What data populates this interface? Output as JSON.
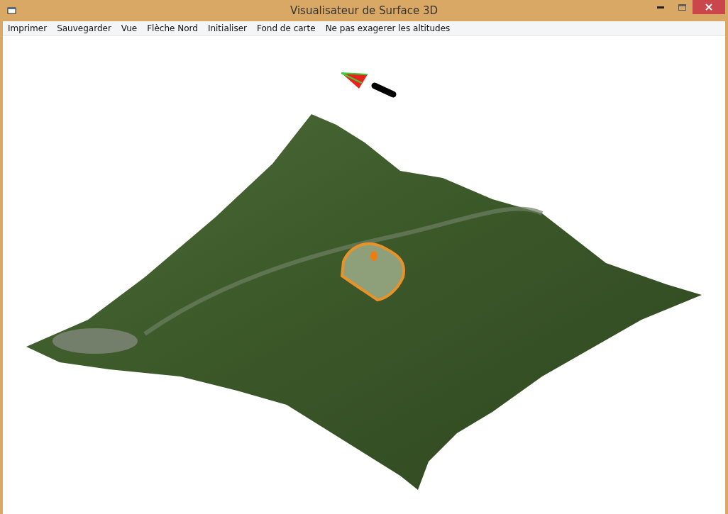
{
  "window": {
    "title": "Visualisateur de Surface 3D"
  },
  "menu": [
    "Imprimer",
    "Sauvegarder",
    "Vue",
    "Flèche Nord",
    "Initialiser",
    "Fond de carte",
    "Ne pas exagerer les altitudes"
  ]
}
